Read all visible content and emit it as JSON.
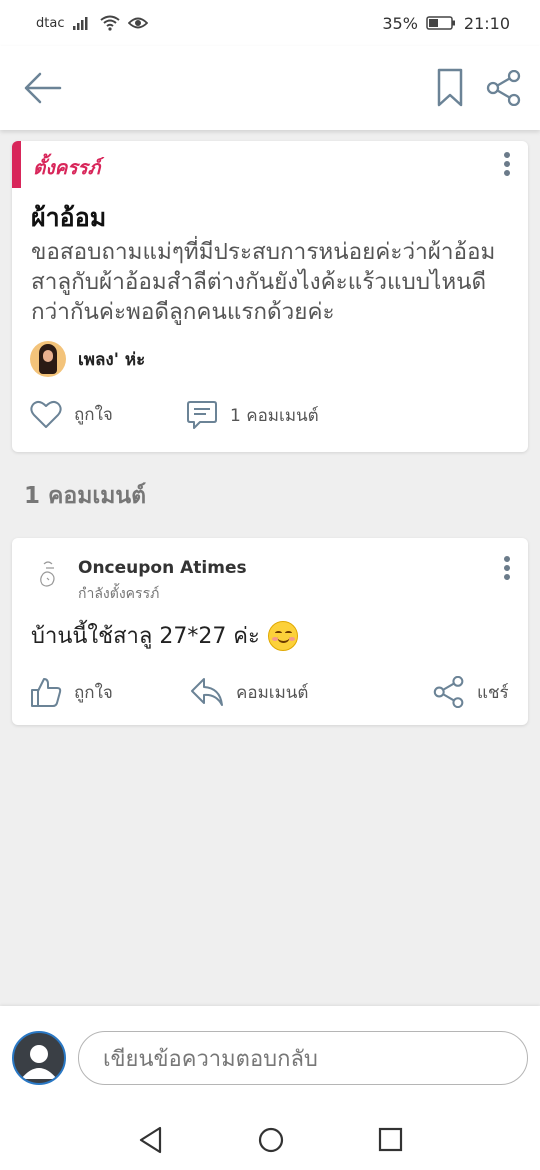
{
  "status": {
    "carrier": "dtac",
    "battery": "35%",
    "time": "21:10"
  },
  "post": {
    "tag": "ตั้งครรภ์",
    "title": "ผ้าอ้อม",
    "body": "ขอสอบถามแม่ๆที่มีประสบการหน่อยค่ะว่าผ้าอ้อมสาลูกับผ้าอ้อมสำลีต่างกันยังไงค้ะแร้วแบบไหนดีกว่ากันค่ะพอดีลูกคนแรกด้วยค่ะ",
    "author": "เพลง' ห่ะ",
    "like_label": "ถูกใจ",
    "comment_label": "1 คอมเมนต์"
  },
  "comments_heading": "1 คอมเมนต์",
  "comment": {
    "author": "Onceupon Atimes",
    "subtitle": "กำลังตั้งครรภ์",
    "text": "บ้านนี้ใช้สาลู 27*27 ค่ะ",
    "like_label": "ถูกใจ",
    "reply_label": "คอมเมนต์",
    "share_label": "แชร์"
  },
  "composer": {
    "placeholder": "เขียนข้อความตอบกลับ"
  },
  "colors": {
    "accent": "#d8265a",
    "icon": "#6b8396",
    "avatar_ring": "#2a78c4"
  }
}
